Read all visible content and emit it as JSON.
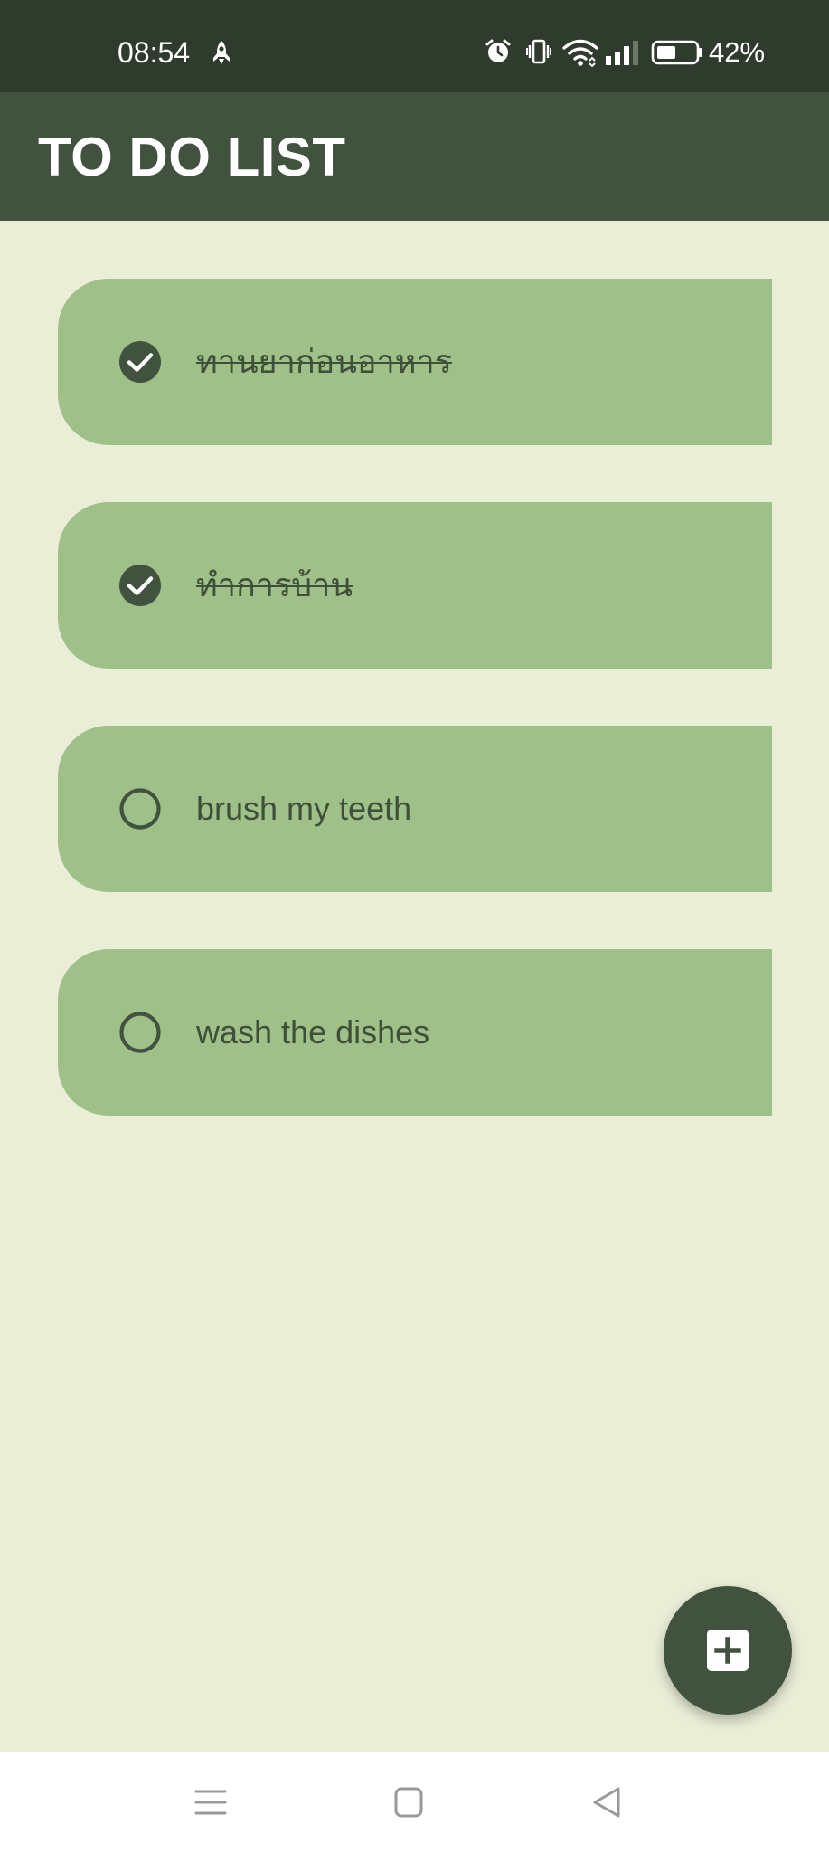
{
  "status_bar": {
    "time": "08:54",
    "battery_percent": "42%",
    "icons": [
      "rocket-icon",
      "alarm-icon",
      "vibrate-icon",
      "wifi-icon",
      "signal-icon",
      "battery-icon"
    ]
  },
  "app_bar": {
    "title": "TO DO LIST"
  },
  "todos": [
    {
      "text": "ทานยาก่อนอาหาร",
      "done": true
    },
    {
      "text": "ทำการบ้าน",
      "done": true
    },
    {
      "text": "brush my teeth",
      "done": false
    },
    {
      "text": "wash the dishes",
      "done": false
    }
  ],
  "fab": {
    "icon": "add-icon"
  },
  "nav_bar": {
    "icons": [
      "menu-icon",
      "home-icon",
      "back-icon"
    ]
  },
  "colors": {
    "status_bar": "#2f3b2c",
    "app_bar": "#41523e",
    "background": "#ebeed7",
    "card": "#9fc089",
    "accent": "#41523e"
  }
}
